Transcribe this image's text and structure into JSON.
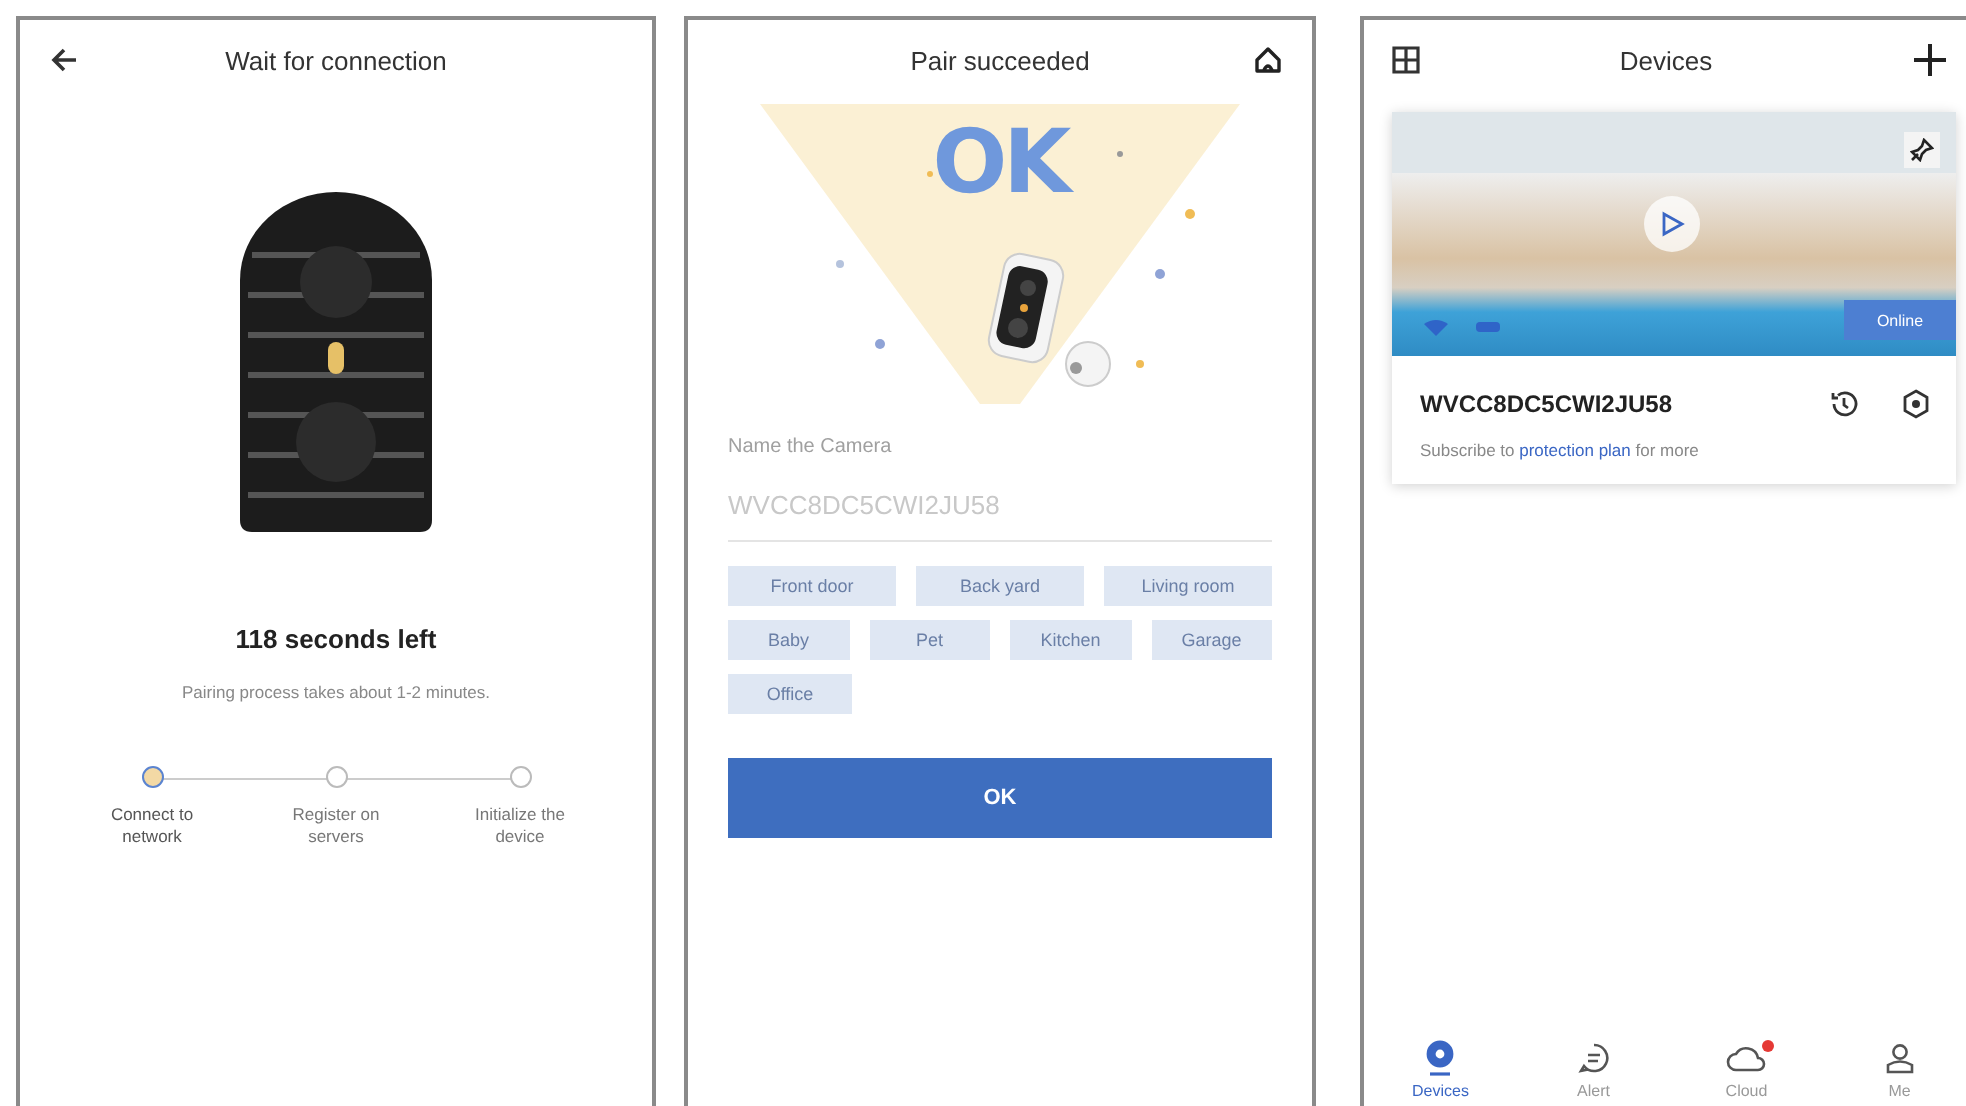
{
  "wait_screen": {
    "title": "Wait for connection",
    "countdown": "118 seconds left",
    "note": "Pairing process takes about 1-2 minutes.",
    "steps": [
      {
        "label": "Connect to network",
        "selected": true
      },
      {
        "label": "Register on servers",
        "selected": false
      },
      {
        "label": "Initialize the device",
        "selected": false
      }
    ]
  },
  "pair_screen": {
    "title": "Pair succeeded",
    "artwork_text": "OK",
    "name_label": "Name the Camera",
    "name_field": {
      "placeholder": "WVCC8DC5CWI2JU58"
    },
    "tag_rows": [
      [
        "Front door",
        "Back yard",
        "Living room"
      ],
      [
        "Baby",
        "Pet",
        "Kitchen",
        "Garage"
      ],
      [
        "Office"
      ]
    ],
    "button": "OK"
  },
  "devices_screen": {
    "title": "Devices",
    "device": {
      "status": "Online",
      "name": "WVCC8DC5CWI2JU58",
      "subscribe": "Subscribe to",
      "link": "protection plan",
      "subscribe_end": "for more"
    },
    "nav": [
      {
        "label": "Devices",
        "kind": "camera",
        "selected": true,
        "badge": false
      },
      {
        "label": "Alert",
        "kind": "message",
        "selected": false,
        "badge": false
      },
      {
        "label": "Cloud",
        "kind": "cloud",
        "selected": false,
        "badge": true
      },
      {
        "label": "Me",
        "kind": "person",
        "selected": false,
        "badge": false
      }
    ]
  }
}
